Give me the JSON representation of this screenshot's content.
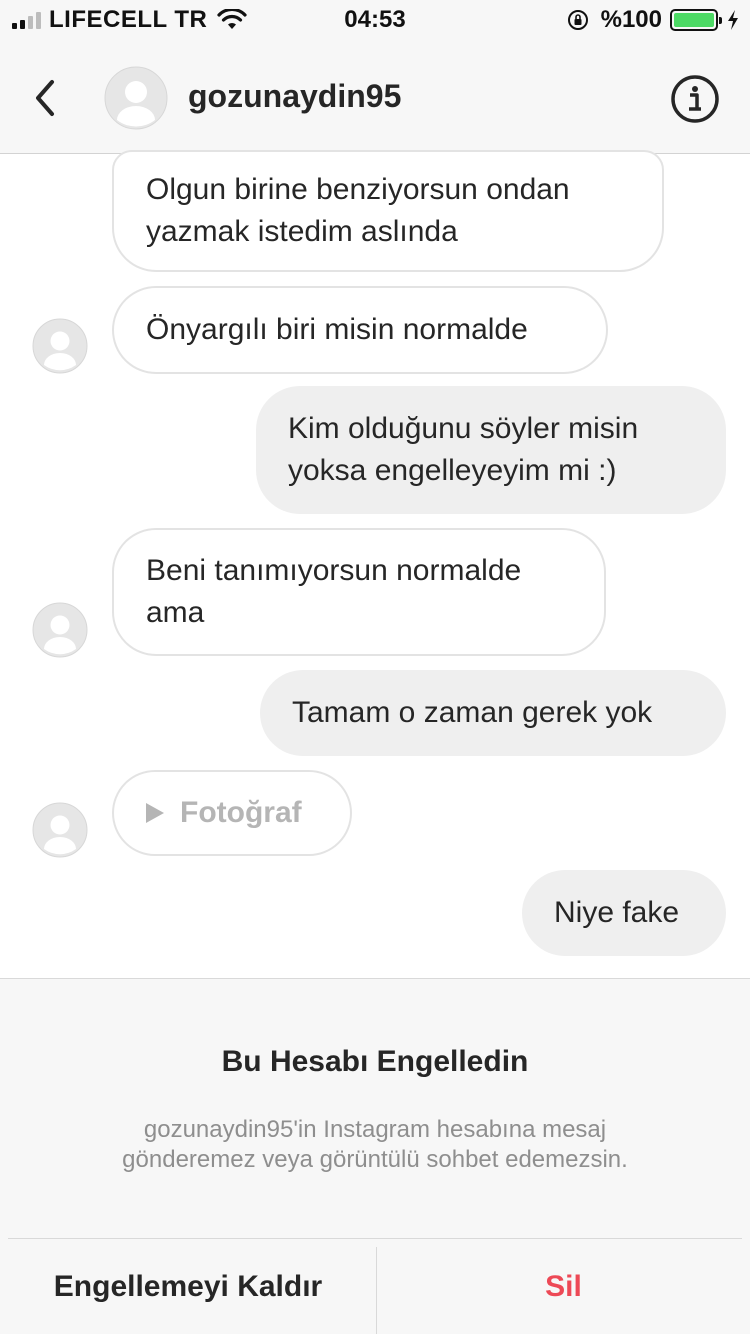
{
  "status_bar": {
    "carrier": "LIFECELL TR",
    "time": "04:53",
    "battery": "%100",
    "battery_level": 1.0,
    "battery_color": "#4cd964",
    "icons": [
      "signal-icon",
      "wifi-icon",
      "rotation-lock-icon",
      "battery-icon",
      "charging-icon"
    ]
  },
  "header": {
    "username": "gozunaydin95",
    "icons": [
      "back-icon",
      "avatar",
      "info-icon"
    ]
  },
  "messages": [
    {
      "side": "in",
      "text_lines": [
        "Olgun birine benziyorsun ondan",
        "yazmak istedim aslında"
      ]
    },
    {
      "side": "in",
      "text_lines": [
        "Önyargılı biri misin normalde"
      ]
    },
    {
      "side": "out",
      "text_lines": [
        "Kim olduğunu söyler misin",
        "yoksa engelleyeyim mi :)"
      ]
    },
    {
      "side": "in",
      "text_lines": [
        "Beni tanımıyorsun normalde",
        "ama"
      ]
    },
    {
      "side": "out",
      "text_lines": [
        "Tamam o zaman gerek yok"
      ]
    },
    {
      "side": "in",
      "type": "photo",
      "text_lines": [
        "Fotoğraf"
      ]
    },
    {
      "side": "out",
      "text_lines": [
        "Niye fake"
      ]
    }
  ],
  "blocked": {
    "title": "Bu Hesabı Engelledin",
    "desc_line1": "gozunaydin95'in Instagram hesabına mesaj",
    "desc_line2": "gönderemez veya görüntülü sohbet edemezsin."
  },
  "actions": {
    "unblock_label": "Engellemeyi Kaldır",
    "delete_label": "Sil",
    "delete_color": "#ed4956"
  }
}
